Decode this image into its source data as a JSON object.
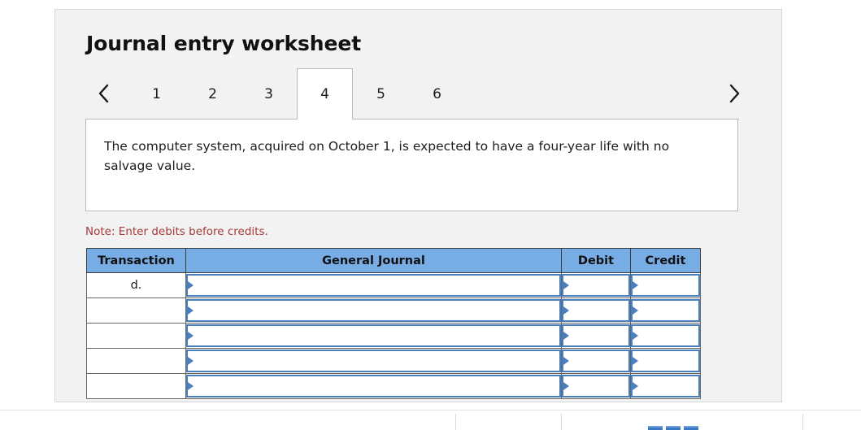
{
  "panel": {
    "title": "Journal entry worksheet"
  },
  "tabs": {
    "prev_icon": "chevron-left-icon",
    "next_icon": "chevron-right-icon",
    "items": [
      {
        "label": "1",
        "active": false
      },
      {
        "label": "2",
        "active": false
      },
      {
        "label": "3",
        "active": false
      },
      {
        "label": "4",
        "active": true
      },
      {
        "label": "5",
        "active": false
      },
      {
        "label": "6",
        "active": false
      }
    ],
    "active_label": "4"
  },
  "scenario": {
    "text": "The computer system, acquired on October 1, is expected to have a four-year life with no salvage value."
  },
  "note": {
    "text": "Note: Enter debits before credits."
  },
  "table": {
    "headers": {
      "transaction": "Transaction",
      "general_journal": "General Journal",
      "debit": "Debit",
      "credit": "Credit"
    },
    "rows": [
      {
        "transaction": "d.",
        "general_journal": "",
        "debit": "",
        "credit": ""
      },
      {
        "transaction": "",
        "general_journal": "",
        "debit": "",
        "credit": ""
      },
      {
        "transaction": "",
        "general_journal": "",
        "debit": "",
        "credit": ""
      },
      {
        "transaction": "",
        "general_journal": "",
        "debit": "",
        "credit": ""
      },
      {
        "transaction": "",
        "general_journal": "",
        "debit": "",
        "credit": ""
      }
    ]
  },
  "colors": {
    "header_blue": "#78ACE5",
    "input_border_blue": "#4a7fbf",
    "note_red": "#a33a3a",
    "panel_bg": "#f2f2f2"
  }
}
